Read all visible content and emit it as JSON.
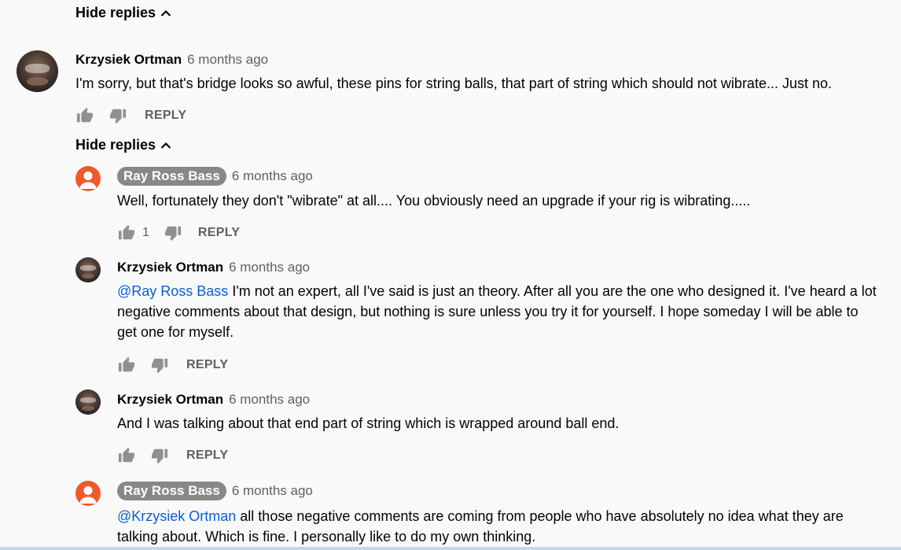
{
  "thread": {
    "hide_replies_top": "Hide replies",
    "hide_replies_second": "Hide replies"
  },
  "comments": [
    {
      "author": "Krzysiek Ortman",
      "time": "6 months ago",
      "text": "I'm sorry, but that's bridge looks so awful, these pins for string balls,  that part of string which should not wibrate... Just no.",
      "reply_label": "REPLY"
    },
    {
      "author": "Ray Ross Bass",
      "time": "6 months ago",
      "text": "Well, fortunately they don't \"wibrate\" at all.... You obviously need an upgrade if your rig is wibrating.....",
      "likes": "1",
      "reply_label": "REPLY"
    },
    {
      "author": "Krzysiek Ortman",
      "time": "6 months ago",
      "mention": "@Ray Ross Bass",
      "lines": [
        " I'm not an expert, all I've said is just an theory. After all you are the one who designed it. I've heard a lot",
        "negative comments about that design, but nothing is sure unless you try it for yourself.  I hope someday I will be able to",
        "get one for myself."
      ],
      "reply_label": "REPLY"
    },
    {
      "author": "Krzysiek Ortman",
      "time": "6 months ago",
      "text": "And I was talking about that end part of string which is wrapped around ball end.",
      "reply_label": "REPLY"
    },
    {
      "author": "Ray Ross Bass",
      "time": "6 months ago",
      "mention": "@Krzysiek Ortman",
      "lines": [
        " all those negative comments are coming from people who have absolutely no idea what they are",
        "talking about.  Which is fine.  I personally like to do my own thinking."
      ]
    }
  ],
  "icons": {
    "like": "thumb-up-icon",
    "dislike": "thumb-down-icon",
    "chevron": "chevron-up-icon",
    "default_avatar": "person-icon"
  },
  "colors": {
    "background": "#f9f9f9",
    "mention": "#065fd4",
    "secondary_text": "#606060",
    "author_chip": "#888888",
    "default_avatar": "#ef5a2b"
  }
}
